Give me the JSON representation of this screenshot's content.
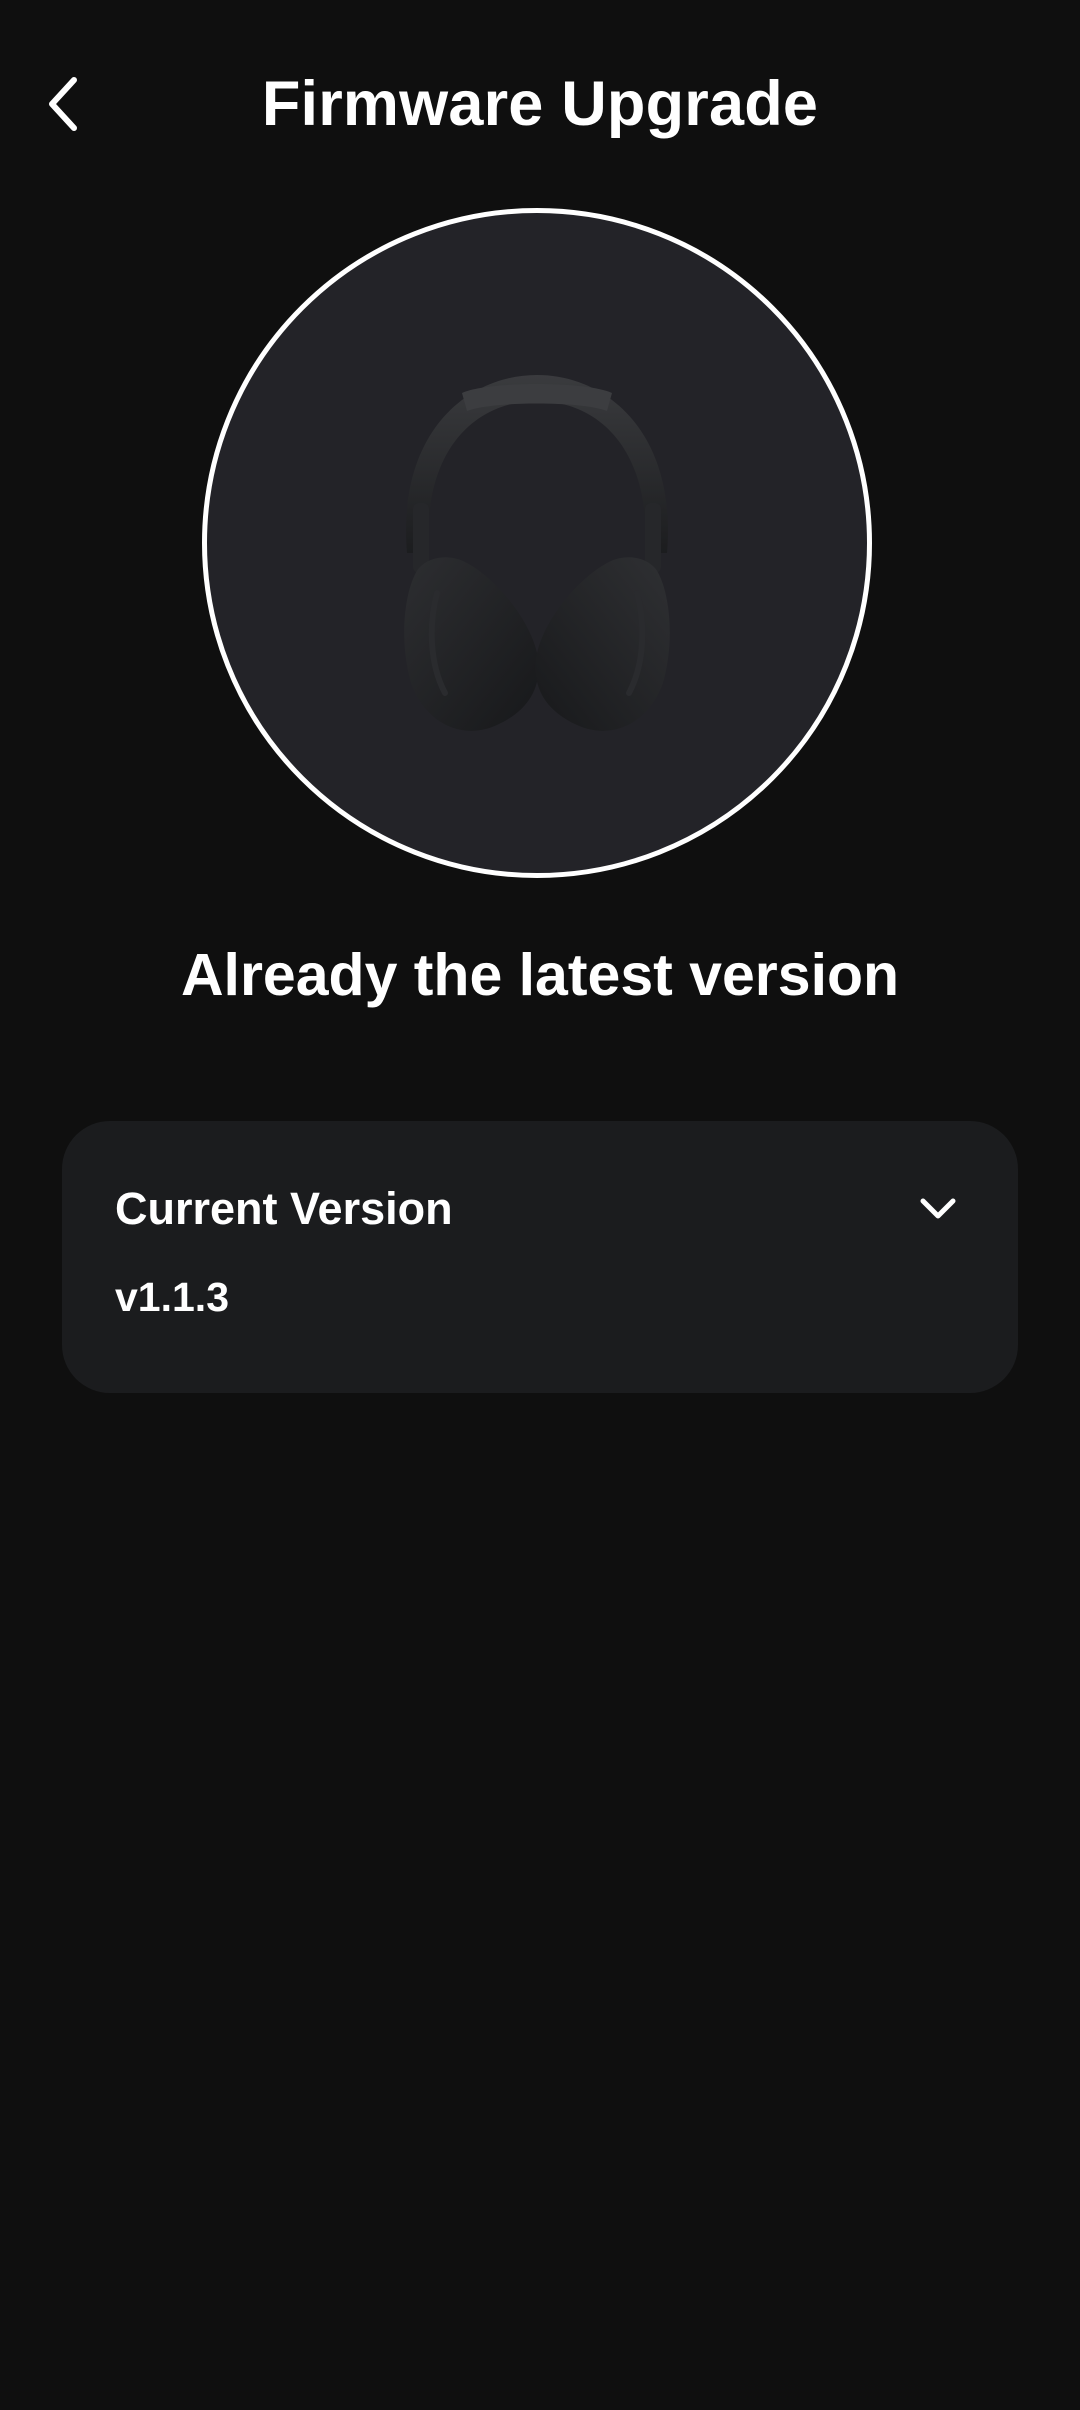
{
  "header": {
    "title": "Firmware Upgrade",
    "back_icon": "chevron-left-icon"
  },
  "device": {
    "image": "headphones-icon",
    "ring_color": "#ffffff",
    "background_color": "#232328"
  },
  "status": {
    "message": "Already the latest version"
  },
  "version_card": {
    "label": "Current Version",
    "value": "v1.1.3",
    "toggle_icon": "chevron-down-icon"
  },
  "colors": {
    "background": "#0f0f0f",
    "card": "#1b1c1e",
    "text": "#ffffff"
  }
}
